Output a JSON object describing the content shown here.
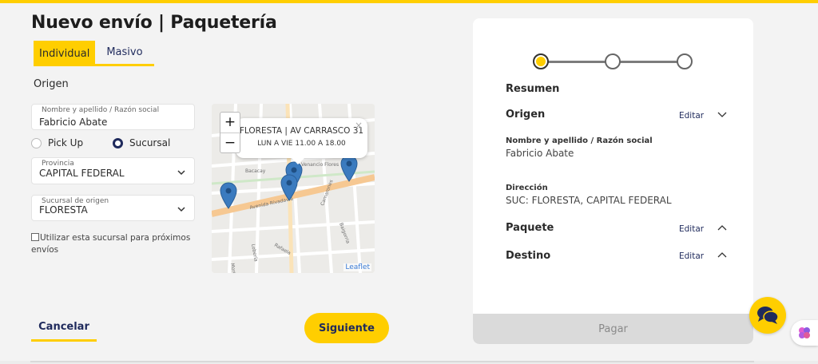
{
  "page": {
    "title": "Nuevo envío | Paquetería"
  },
  "tabs": [
    {
      "label": "Individual",
      "active": true
    },
    {
      "label": "Masivo",
      "active": false
    }
  ],
  "origin": {
    "section_label": "Origen",
    "name_field": {
      "label": "Nombre y apellido / Razón social",
      "value": "Fabricio Abate"
    },
    "delivery_options": [
      {
        "label": "Pick Up",
        "checked": false
      },
      {
        "label": "Sucursal",
        "checked": true
      }
    ],
    "province_field": {
      "label": "Provincia",
      "value": "CAPITAL FEDERAL"
    },
    "branch_field": {
      "label": "Sucursal de origen",
      "value": "FLORESTA"
    },
    "remember_checkbox": {
      "label": "Utilizar esta sucursal para próximos envíos",
      "checked": false
    }
  },
  "map": {
    "popup_title": "FLORESTA | AV CARRASCO 31",
    "popup_subtitle": "LUN A VIE 11.00 A 18.00",
    "zoom_in": "+",
    "zoom_out": "−",
    "close_glyph": "×",
    "attribution": "Leaflet",
    "street_labels": [
      "Bacacay",
      "Avenida Rivadavia",
      "Gavilán",
      "Yerbal",
      "Felipe Vallese",
      "Morón",
      "Rafaela",
      "Joaquín V. González",
      "Bahía Blanca",
      "Sanabria",
      "Mercedes",
      "Moliere",
      "Lobería",
      "Gral. Cesar Díaz",
      "Boyacá",
      "Camarones",
      "Baigorria",
      "Venancio Flores",
      "Ensenada",
      "Campana",
      "Cuenca",
      "Portela",
      "Gral. José G. Artigas",
      "Remedios de Escalada"
    ],
    "marker_color": "#3b7bbf"
  },
  "actions": {
    "cancel": "Cancelar",
    "next": "Siguiente"
  },
  "summary": {
    "heading": "Resumen",
    "steps": [
      {
        "active": true
      },
      {
        "active": false
      },
      {
        "active": false
      }
    ],
    "origin_title": "Origen",
    "origin_edit": "Editar",
    "name_label": "Nombre y apellido / Razón social",
    "name_value": "Fabricio Abate",
    "address_label": "Dirección",
    "address_value": "SUC: FLORESTA, CAPITAL FEDERAL",
    "package_title": "Paquete",
    "package_edit": "Editar",
    "destination_title": "Destino",
    "destination_edit": "Editar",
    "pay_button": "Pagar"
  },
  "colors": {
    "accent": "#ffce00",
    "navy": "#1f2a5c",
    "disabled": "#dadada"
  },
  "icons": [
    "chevron-down-icon",
    "chevron-up-icon",
    "map-marker-icon",
    "chat-icon",
    "brain-icon"
  ]
}
